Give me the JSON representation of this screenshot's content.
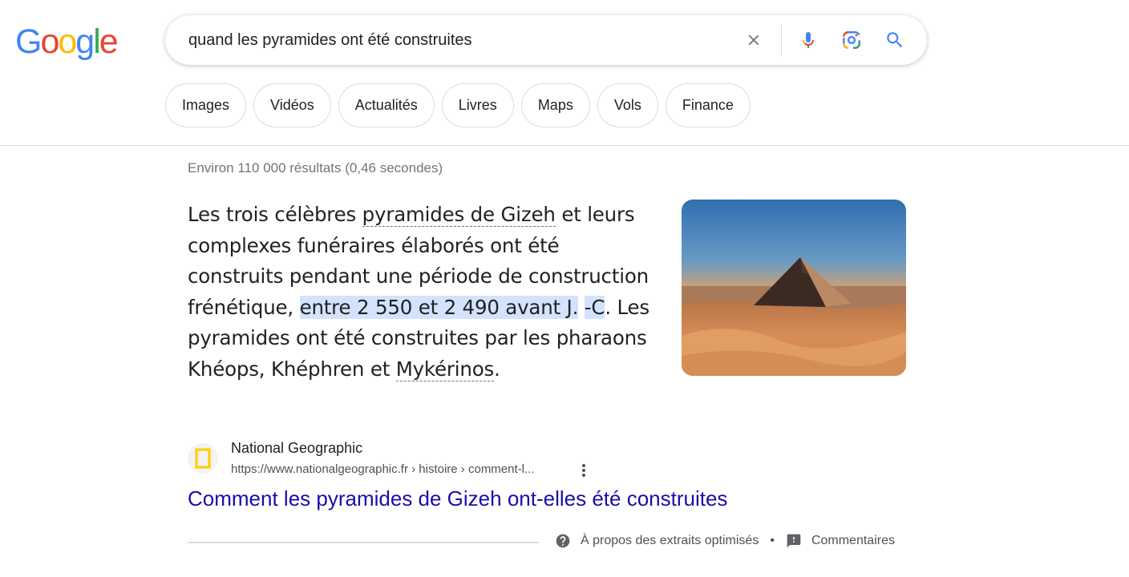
{
  "logo": {
    "letters": [
      "G",
      "o",
      "o",
      "g",
      "l",
      "e"
    ],
    "colors": [
      "#4285F4",
      "#EA4335",
      "#FBBC05",
      "#4285F4",
      "#34A853",
      "#EA4335"
    ]
  },
  "search": {
    "query": "quand les pyramides ont été construites",
    "icons": [
      "close-icon",
      "microphone-icon",
      "lens-camera-icon",
      "search-icon"
    ]
  },
  "chips": [
    {
      "label": "Images"
    },
    {
      "label": "Vidéos"
    },
    {
      "label": "Actualités"
    },
    {
      "label": "Livres"
    },
    {
      "label": "Maps"
    },
    {
      "label": "Vols"
    },
    {
      "label": "Finance"
    }
  ],
  "stats": "Environ 110 000 résultats (0,46 secondes)",
  "snippet": {
    "part1": "Les trois célèbres ",
    "link1": "pyramides de Gizeh",
    "part2": " et leurs complexes funéraires élaborés ont été construits pendant une période de construction frénétique, ",
    "highlight1": "entre 2 550 et 2 490 avant J.",
    "highlight_space": " ",
    "highlight2": "-C",
    "part3": ". Les pyramides ont été construites par les pharaons Khéops, Khéphren et ",
    "link2": "Mykérinos",
    "part4": "."
  },
  "source": {
    "name": "National Geographic",
    "url": "https://www.nationalgeographic.fr › histoire › comment-l...",
    "title": "Comment les pyramides de Gizeh ont-elles été construites",
    "favicon_color": "#FFCE00"
  },
  "footer": {
    "about": "À propos des extraits optimisés",
    "separator": "•",
    "feedback": "Commentaires"
  },
  "colors": {
    "link": "#1a0dab",
    "highlight": "#d3e3fd",
    "muted": "#70757a"
  }
}
